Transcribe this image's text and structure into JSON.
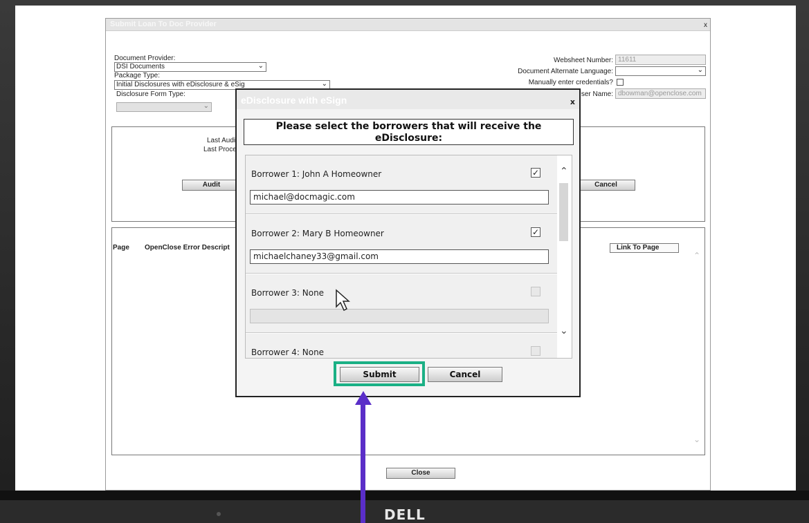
{
  "main_dialog": {
    "title": "Submit Loan To Doc Provider",
    "close_glyph": "x",
    "document_provider_label": "Document Provider:",
    "document_provider_value": "DSI Documents",
    "package_type_label": "Package Type:",
    "package_type_value": "Initial Disclosures with eDisclosure & eSig",
    "disclosure_form_type_label": "Disclosure Form Type:",
    "disclosure_form_type_value": "",
    "websheet_number_label": "Websheet Number:",
    "websheet_number_value": "11611",
    "alt_language_label": "Document Alternate Language:",
    "alt_language_value": "",
    "manual_credentials_label": "Manually enter credentials?",
    "user_name_label": "User Name:",
    "user_name_value": "dbowman@openclose.com",
    "last_audit_label": "Last Audit",
    "last_process_label": "Last Process",
    "audit_button": "Audit",
    "cancel_button": "Cancel",
    "col_page": "Page",
    "col_error": "OpenClose Error Descript",
    "col_link": "Link To Page",
    "close_button": "Close"
  },
  "modal": {
    "title": "eDisclosure with eSign",
    "close_glyph": "x",
    "heading": "Please select the borrowers that will receive the eDisclosure:",
    "borrowers": [
      {
        "name": "Borrower 1: John A Homeowner",
        "checked": true,
        "email": "michael@docmagic.com"
      },
      {
        "name": "Borrower 2: Mary B Homeowner",
        "checked": true,
        "email": "michaelchaney33@gmail.com"
      },
      {
        "name": "Borrower 3: None",
        "checked": false,
        "email": ""
      },
      {
        "name": "Borrower 4: None",
        "checked": false,
        "email": ""
      }
    ],
    "check_glyph": "✓",
    "submit_button": "Submit",
    "cancel_button": "Cancel"
  },
  "bezel": {
    "brand": "DELL"
  },
  "colors": {
    "highlight": "#1bb085",
    "arrow": "#5a2ec8"
  },
  "icons": [
    "chevron-down-icon",
    "chevron-up-icon",
    "checkbox-icon",
    "mouse-pointer-icon",
    "up-arrow-icon"
  ]
}
